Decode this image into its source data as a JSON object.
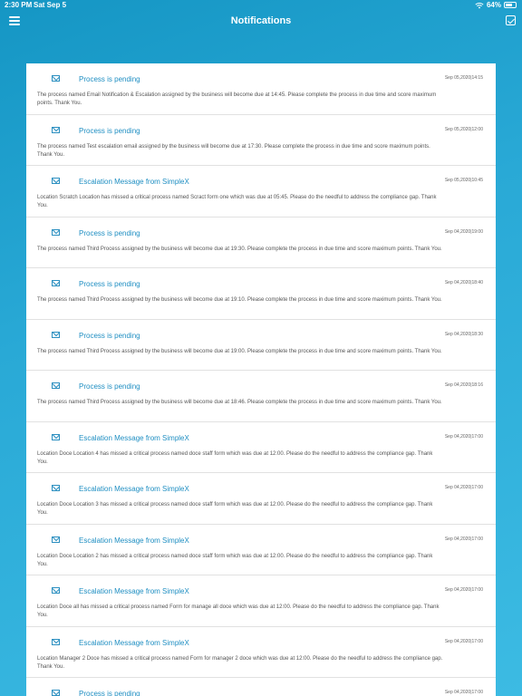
{
  "status": {
    "time": "2:30 PM",
    "date": "Sat Sep 5",
    "battery": "64%",
    "battery_level": 0.64
  },
  "header": {
    "title": "Notifications"
  },
  "notifications": [
    {
      "title": "Process is pending",
      "time": "Sep 05,2020|14:15",
      "body": "The process named Email Notification & Escalation assigned by the business will become due at 14:45. Please complete the process in due time and score maximum points. Thank You."
    },
    {
      "title": "Process is pending",
      "time": "Sep 05,2020|12:00",
      "body": "The process named Test escalation email assigned by the business will become due at 17:30. Please complete the process in due time and score maximum points. Thank You."
    },
    {
      "title": "Escalation Message from SimpleX",
      "time": "Sep 05,2020|10:45",
      "body": "Location Scratch Location has missed a critical process named Scract form one which was due at 05:45. Please do the needful to address the compliance gap. Thank You."
    },
    {
      "title": "Process is pending",
      "time": "Sep 04,2020|19:00",
      "body": "The process named Third Process assigned by the business will become due at 19:30. Please complete the process in due time and score maximum points. Thank You."
    },
    {
      "title": "Process is pending",
      "time": "Sep 04,2020|18:40",
      "body": "The process named Third Process assigned by the business will become due at 19:10. Please complete the process in due time and score maximum points. Thank You."
    },
    {
      "title": "Process is pending",
      "time": "Sep 04,2020|18:30",
      "body": "The process named Third Process assigned by the business will become due at 19:00. Please complete the process in due time and score maximum points. Thank You."
    },
    {
      "title": "Process is pending",
      "time": "Sep 04,2020|18:16",
      "body": "The process named Third Process assigned by the business will become due at 18:46. Please complete the process in due time and score maximum points. Thank You."
    },
    {
      "title": "Escalation Message from SimpleX",
      "time": "Sep 04,2020|17:00",
      "body": "Location Doce Location 4 has missed a critical process named doce staff form which was due at 12:00. Please do the needful to address the compliance gap. Thank You."
    },
    {
      "title": "Escalation Message from SimpleX",
      "time": "Sep 04,2020|17:00",
      "body": "Location Doce Location 3 has missed a critical process named doce staff form which was due at 12:00. Please do the needful to address the compliance gap. Thank You."
    },
    {
      "title": "Escalation Message from SimpleX",
      "time": "Sep 04,2020|17:00",
      "body": "Location Doce Location 2 has missed a critical process named doce staff form which was due at 12:00. Please do the needful to address the compliance gap. Thank You."
    },
    {
      "title": "Escalation Message from SimpleX",
      "time": "Sep 04,2020|17:00",
      "body": "Location Doce all has missed a critical process named Form for manage all doce which was due at 12:00. Please do the needful to address the compliance gap. Thank You."
    },
    {
      "title": "Escalation Message from SimpleX",
      "time": "Sep 04,2020|17:00",
      "body": "Location Manager 2 Doce has missed a critical process named Form for manager 2 doce which was due at 12:00. Please do the needful to address the compliance gap. Thank You."
    },
    {
      "title": "Process is pending",
      "time": "Sep 04,2020|17:00",
      "body": ""
    }
  ]
}
